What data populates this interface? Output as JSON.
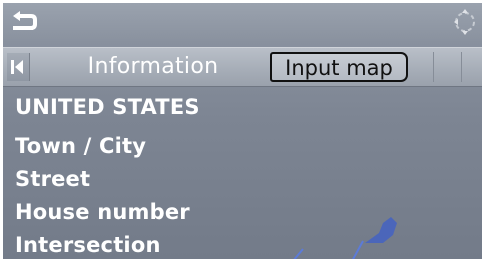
{
  "tabs": {
    "information_label": "Information",
    "input_map_label": "Input map"
  },
  "menu": {
    "items": [
      {
        "label": "UNITED STATES"
      },
      {
        "label": "Town / City"
      },
      {
        "label": "Street"
      },
      {
        "label": "House number"
      },
      {
        "label": "Intersection"
      }
    ]
  },
  "icons": {
    "back": "back-arrow-icon",
    "controller": "controller-icon",
    "tab_left": "tab-left-arrow-icon"
  },
  "colors": {
    "background": "#7d8593",
    "text": "#ffffff",
    "selected_tab_border": "#111111"
  }
}
